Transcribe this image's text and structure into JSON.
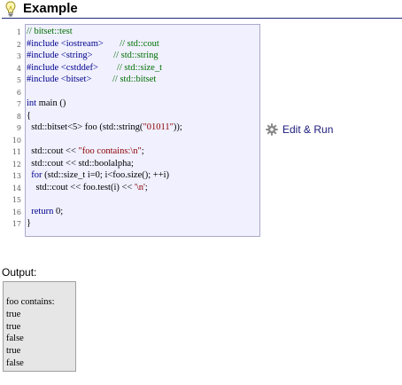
{
  "header": {
    "title": "Example",
    "icon": "lightbulb-icon"
  },
  "code": {
    "line_numbers": [
      "1",
      "2",
      "3",
      "4",
      "5",
      "6",
      "7",
      "8",
      "9",
      "10",
      "11",
      "12",
      "13",
      "14",
      "15",
      "16",
      "17"
    ],
    "lines": [
      {
        "parts": [
          {
            "t": "// bitset::test",
            "c": "cm"
          }
        ]
      },
      {
        "parts": [
          {
            "t": "#include <iostream>",
            "c": "pp"
          },
          {
            "t": "       // std::cout",
            "c": "cm"
          }
        ]
      },
      {
        "parts": [
          {
            "t": "#include <string>",
            "c": "pp"
          },
          {
            "t": "         // std::string",
            "c": "cm"
          }
        ]
      },
      {
        "parts": [
          {
            "t": "#include <cstddef>",
            "c": "pp"
          },
          {
            "t": "        // std::size_t",
            "c": "cm"
          }
        ]
      },
      {
        "parts": [
          {
            "t": "#include <bitset>",
            "c": "pp"
          },
          {
            "t": "         // std::bitset",
            "c": "cm"
          }
        ]
      },
      {
        "parts": [
          {
            "t": "",
            "c": ""
          }
        ]
      },
      {
        "parts": [
          {
            "t": "int",
            "c": "kw"
          },
          {
            "t": " main ()",
            "c": ""
          }
        ]
      },
      {
        "parts": [
          {
            "t": "{",
            "c": ""
          }
        ]
      },
      {
        "parts": [
          {
            "t": "  std::bitset<5> foo (std::string(",
            "c": ""
          },
          {
            "t": "\"01011\"",
            "c": "str"
          },
          {
            "t": "));",
            "c": ""
          }
        ]
      },
      {
        "parts": [
          {
            "t": "",
            "c": ""
          }
        ]
      },
      {
        "parts": [
          {
            "t": "  std::cout << ",
            "c": ""
          },
          {
            "t": "\"foo contains:\\n\"",
            "c": "str"
          },
          {
            "t": ";",
            "c": ""
          }
        ]
      },
      {
        "parts": [
          {
            "t": "  std::cout << std::boolalpha;",
            "c": ""
          }
        ]
      },
      {
        "parts": [
          {
            "t": "  ",
            "c": ""
          },
          {
            "t": "for",
            "c": "kw"
          },
          {
            "t": " (std::size_t i=0; i<foo.size(); ++i)",
            "c": ""
          }
        ]
      },
      {
        "parts": [
          {
            "t": "    std::cout << foo.test(i) << ",
            "c": ""
          },
          {
            "t": "'\\n'",
            "c": "str"
          },
          {
            "t": ";",
            "c": ""
          }
        ]
      },
      {
        "parts": [
          {
            "t": "",
            "c": ""
          }
        ]
      },
      {
        "parts": [
          {
            "t": "  ",
            "c": ""
          },
          {
            "t": "return",
            "c": "kw"
          },
          {
            "t": " 0;",
            "c": ""
          }
        ]
      },
      {
        "parts": [
          {
            "t": "}",
            "c": ""
          }
        ]
      }
    ]
  },
  "edit_run": {
    "label": "Edit & Run",
    "icon": "gear-icon"
  },
  "output": {
    "label": "Output:",
    "lines": [
      "foo contains:",
      "true",
      "true",
      "false",
      "true",
      "false"
    ]
  },
  "colors": {
    "code_bg": "#f0f0ff",
    "output_bg": "#e6e6e6",
    "comment": "#007000",
    "string": "#8b0000",
    "keyword": "#00008b",
    "header_rule": "#1f2a7a"
  }
}
